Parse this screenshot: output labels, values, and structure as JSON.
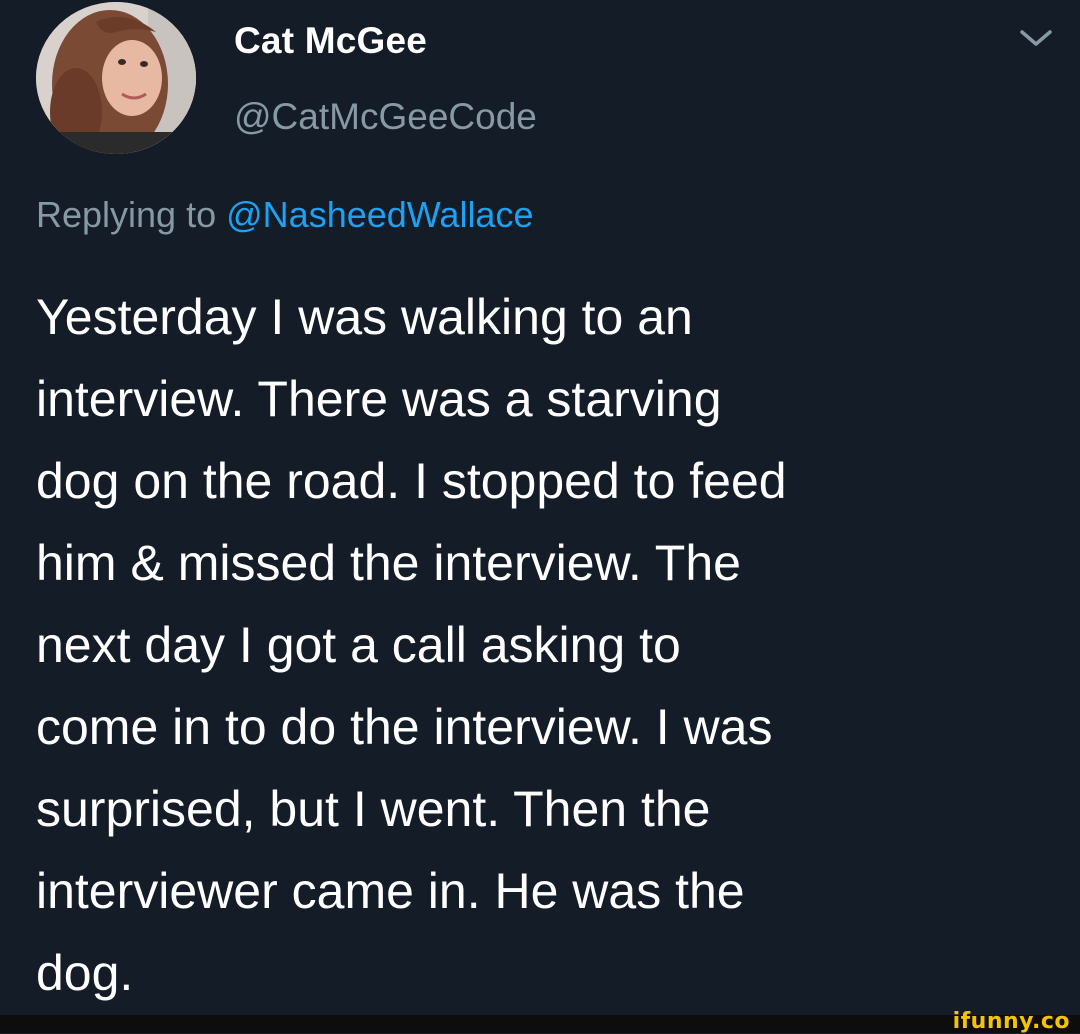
{
  "theme": {
    "background": "#15202b",
    "text_primary": "#ffffff",
    "text_secondary": "#8899a6",
    "link": "#1da1f2",
    "watermark": "#f5c400"
  },
  "author": {
    "display_name": "Cat McGee",
    "handle": "@CatMcGeeCode",
    "avatar_icon": "profile-photo"
  },
  "menu": {
    "icon": "chevron-down-icon"
  },
  "reply": {
    "prefix": "Replying to",
    "mention": "@NasheedWallace"
  },
  "tweet": {
    "lines": [
      "Yesterday I was walking to an",
      "interview. There was a starving",
      "dog on the road. I stopped to feed",
      "him & missed the interview. The",
      "next day I got a call asking to",
      "come in to do the interview. I was",
      "surprised, but I went. Then the",
      "interviewer came in. He was the",
      "dog."
    ]
  },
  "watermark": {
    "text": "ifunny.co"
  }
}
